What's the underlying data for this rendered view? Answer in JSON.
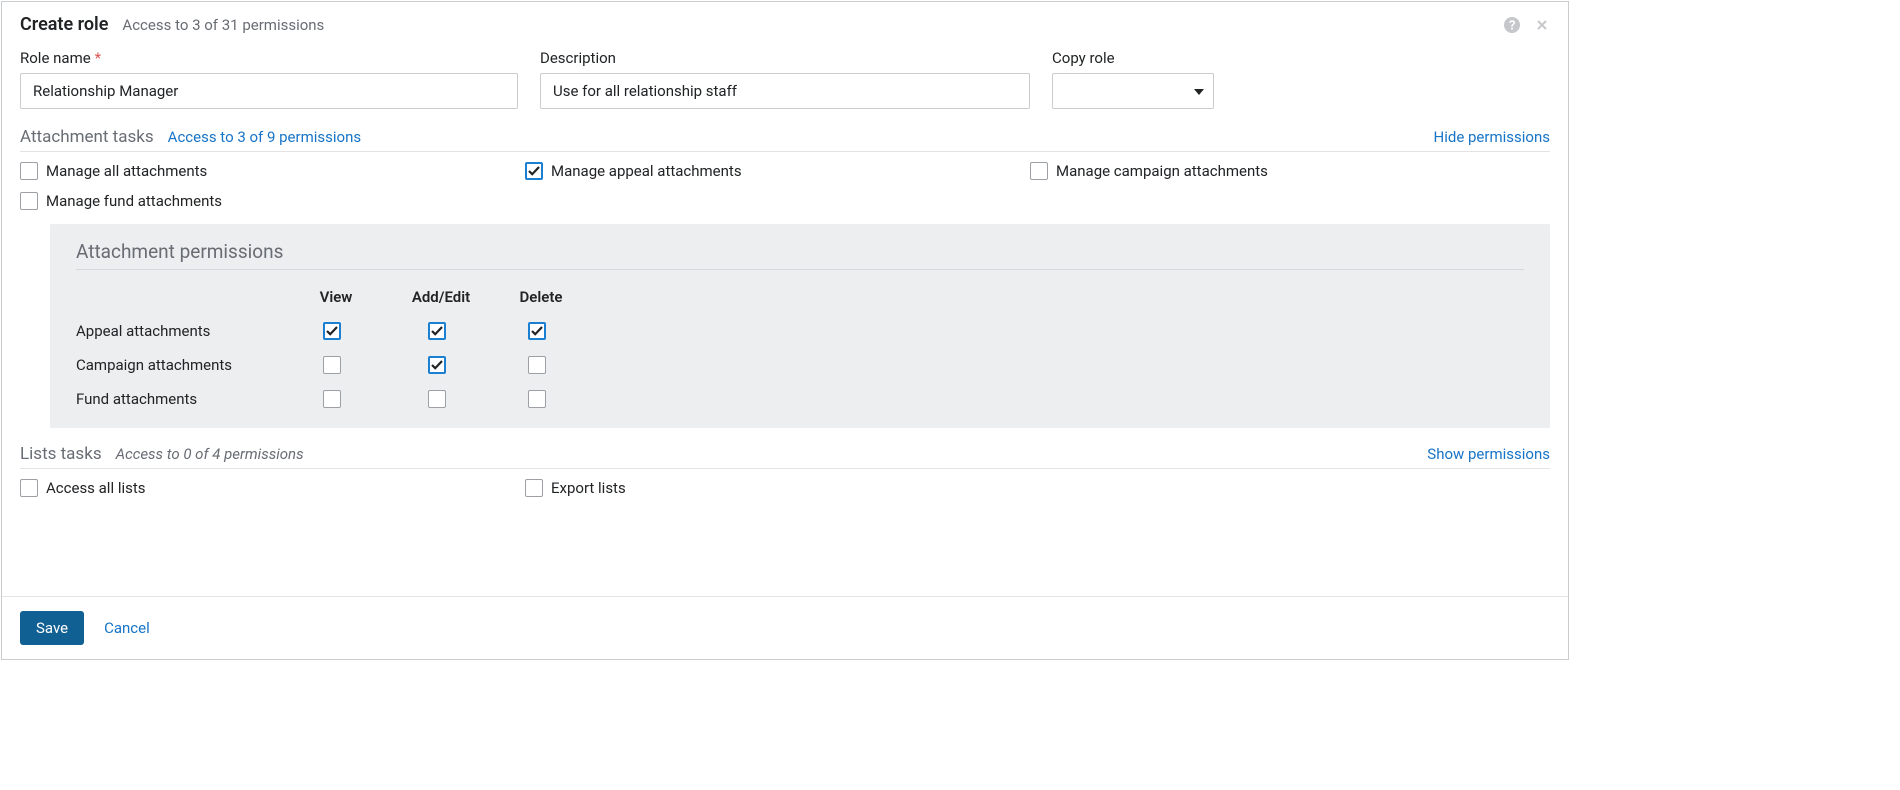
{
  "header": {
    "title": "Create role",
    "subtitle": "Access to 3 of 31 permissions"
  },
  "fields": {
    "roleName": {
      "label": "Role name",
      "value": "Relationship Manager",
      "required": true
    },
    "description": {
      "label": "Description",
      "value": "Use for all relationship staff"
    },
    "copyRole": {
      "label": "Copy role",
      "value": ""
    }
  },
  "sections": {
    "attachment": {
      "title": "Attachment tasks",
      "countText": "Access to 3 of 9 permissions",
      "toggleLabel": "Hide permissions",
      "checks": {
        "manageAll": {
          "label": "Manage all attachments",
          "checked": false
        },
        "manageAppeal": {
          "label": "Manage appeal attachments",
          "checked": true
        },
        "manageCampaign": {
          "label": "Manage campaign attachments",
          "checked": false
        },
        "manageFund": {
          "label": "Manage fund attachments",
          "checked": false
        }
      },
      "permPanel": {
        "title": "Attachment permissions",
        "cols": {
          "view": "View",
          "addEdit": "Add/Edit",
          "delete": "Delete"
        },
        "rows": [
          {
            "label": "Appeal attachments",
            "view": true,
            "addEdit": true,
            "delete": true
          },
          {
            "label": "Campaign attachments",
            "view": false,
            "addEdit": true,
            "delete": false
          },
          {
            "label": "Fund attachments",
            "view": false,
            "addEdit": false,
            "delete": false
          }
        ]
      }
    },
    "lists": {
      "title": "Lists tasks",
      "countText": "Access to 0 of 4 permissions",
      "toggleLabel": "Show permissions",
      "checks": {
        "accessAll": {
          "label": "Access all lists",
          "checked": false
        },
        "exportLists": {
          "label": "Export lists",
          "checked": false
        }
      }
    }
  },
  "footer": {
    "save": "Save",
    "cancel": "Cancel"
  }
}
